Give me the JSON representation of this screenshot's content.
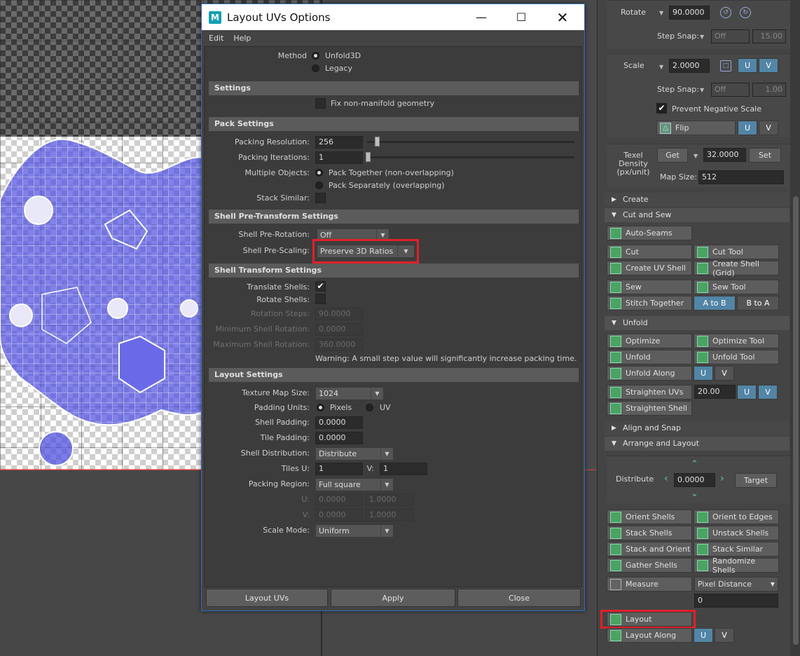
{
  "dialog": {
    "title": "Layout UVs Options",
    "logo_letter": "M",
    "menu": [
      "Edit",
      "Help"
    ],
    "method": {
      "label": "Method",
      "options": [
        "Unfold3D",
        "Legacy"
      ],
      "selected": "Unfold3D"
    },
    "settings": {
      "header": "Settings",
      "fix_nonmanifold": "Fix non-manifold geometry"
    },
    "pack": {
      "header": "Pack Settings",
      "resolution_label": "Packing Resolution:",
      "resolution_value": "256",
      "iterations_label": "Packing Iterations:",
      "iterations_value": "1",
      "multiple_label": "Multiple Objects:",
      "multiple_options": [
        "Pack Together (non-overlapping)",
        "Pack Separately (overlapping)"
      ],
      "stack_label": "Stack Similar:"
    },
    "pre_transform": {
      "header": "Shell Pre-Transform Settings",
      "rotation_label": "Shell Pre-Rotation:",
      "rotation_value": "Off",
      "scaling_label": "Shell Pre-Scaling:",
      "scaling_value": "Preserve 3D Ratios"
    },
    "transform": {
      "header": "Shell Transform Settings",
      "translate_label": "Translate Shells:",
      "rotate_label": "Rotate Shells:",
      "rotation_steps_label": "Rotation Steps:",
      "rotation_steps_value": "90.0000",
      "min_rot_label": "Minimum Shell Rotation:",
      "min_rot_value": "0.0000",
      "max_rot_label": "Maximum Shell Rotation:",
      "max_rot_value": "360.0000",
      "warning": "Warning: A small step value will significantly increase packing time."
    },
    "layout": {
      "header": "Layout Settings",
      "texture_label": "Texture Map Size:",
      "texture_value": "1024",
      "padding_units_label": "Padding Units:",
      "padding_units_options": [
        "Pixels",
        "UV"
      ],
      "shell_padding_label": "Shell Padding:",
      "shell_padding_value": "0.0000",
      "tile_padding_label": "Tile Padding:",
      "tile_padding_value": "0.0000",
      "distribution_label": "Shell Distribution:",
      "distribution_value": "Distribute",
      "tiles_u_label": "Tiles U:",
      "tiles_u_value": "1",
      "tiles_v_label": "V:",
      "tiles_v_value": "1",
      "region_label": "Packing Region:",
      "region_value": "Full square",
      "u_label": "U:",
      "u_min": "0.0000",
      "u_max": "1.0000",
      "v_label": "V:",
      "v_min": "0.0000",
      "v_max": "1.0000",
      "scale_label": "Scale Mode:",
      "scale_value": "Uniform"
    },
    "buttons": {
      "layout": "Layout UVs",
      "apply": "Apply",
      "close": "Close"
    }
  },
  "panel": {
    "rotate_label": "Rotate",
    "rotate_value": "90.0000",
    "step_snap_label": "Step Snap:",
    "step_snap_value": "Off",
    "rotate_snap_value": "15.00",
    "scale_label": "Scale",
    "scale_value": "2.0000",
    "scale_snap_value": "1.00",
    "prevent_neg_scale": "Prevent Negative Scale",
    "flip": "Flip",
    "u": "U",
    "v": "V",
    "texel_label": "Texel Density (px/unit)",
    "get": "Get",
    "texel_value": "32.0000",
    "set": "Set",
    "map_size_label": "Map Size:",
    "map_size_value": "512",
    "sections": {
      "create": "Create",
      "cut_sew": "Cut and Sew",
      "unfold": "Unfold",
      "align_snap": "Align and Snap",
      "arrange_layout": "Arrange and Layout"
    },
    "cut_sew_buttons": {
      "auto_seams": "Auto-Seams",
      "cut": "Cut",
      "cut_tool": "Cut Tool",
      "create_uv_shell": "Create UV Shell",
      "create_shell_grid": "Create Shell (Grid)",
      "sew": "Sew",
      "sew_tool": "Sew Tool",
      "stitch_together": "Stitch Together",
      "a_to_b": "A to B",
      "b_to_a": "B to A"
    },
    "unfold_buttons": {
      "optimize": "Optimize",
      "optimize_tool": "Optimize Tool",
      "unfold": "Unfold",
      "unfold_tool": "Unfold Tool",
      "unfold_along": "Unfold Along",
      "straighten_uvs": "Straighten UVs",
      "straighten_value": "20.00",
      "straighten_shell": "Straighten Shell"
    },
    "arrange": {
      "distribute_label": "Distribute",
      "distribute_value": "0.0000",
      "target": "Target",
      "orient_shells": "Orient Shells",
      "orient_edges": "Orient to Edges",
      "stack_shells": "Stack Shells",
      "unstack_shells": "Unstack Shells",
      "stack_orient": "Stack and Orient",
      "stack_similar": "Stack Similar",
      "gather_shells": "Gather Shells",
      "randomize_shells": "Randomize Shells",
      "measure": "Measure",
      "pixel_distance": "Pixel Distance",
      "measure_value": "0",
      "layout": "Layout",
      "layout_along": "Layout Along"
    }
  },
  "colors": {
    "highlight_red": "#e0202a",
    "toggle_blue": "#5285a6",
    "uv_shell": "#5555e0"
  }
}
